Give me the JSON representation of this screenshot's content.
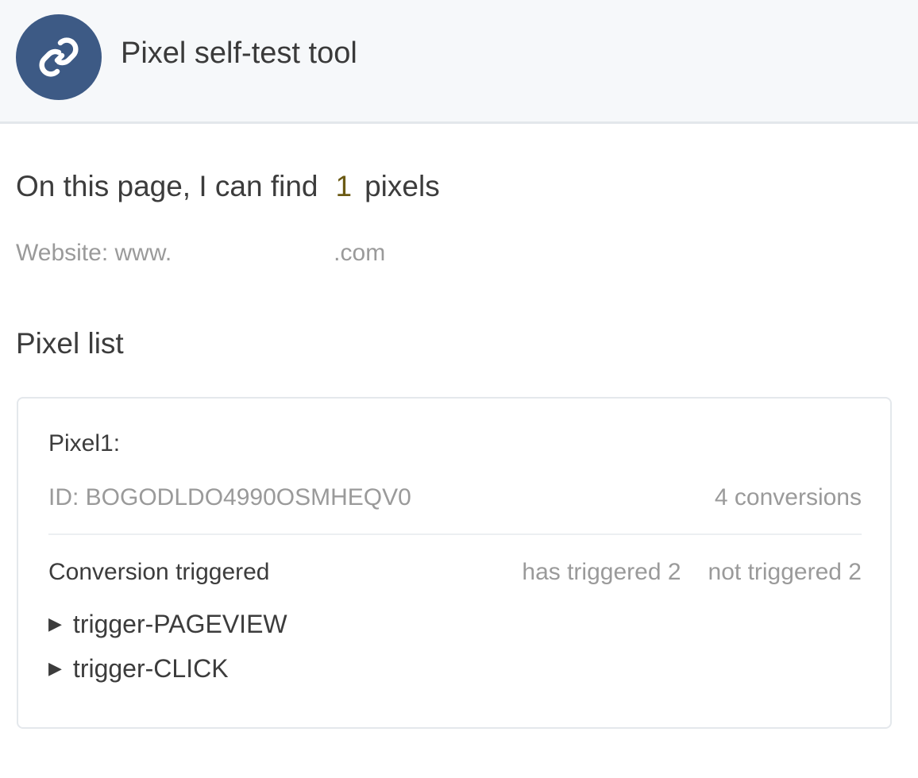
{
  "header": {
    "title": "Pixel self-test tool",
    "logo_icon": "pixel-link-logo-icon",
    "logo_color": "#3d5a85"
  },
  "summary": {
    "prefix": "On this page, I can find",
    "count": "1",
    "suffix": "pixels"
  },
  "website": {
    "prefix": "Website: www.",
    "suffix": ".com"
  },
  "pixel_list": {
    "title": "Pixel list",
    "pixels": [
      {
        "name": "Pixel1:",
        "id": "ID: BOGODLDO4990OSMHEQV0",
        "conversions": "4 conversions",
        "conversion_label": "Conversion triggered",
        "has_triggered": "has triggered 2",
        "not_triggered": "not triggered 2",
        "triggers": [
          {
            "label": "trigger-PAGEVIEW",
            "icon": "caret-right-icon"
          },
          {
            "label": "trigger-CLICK",
            "icon": "caret-right-icon"
          }
        ]
      }
    ]
  }
}
